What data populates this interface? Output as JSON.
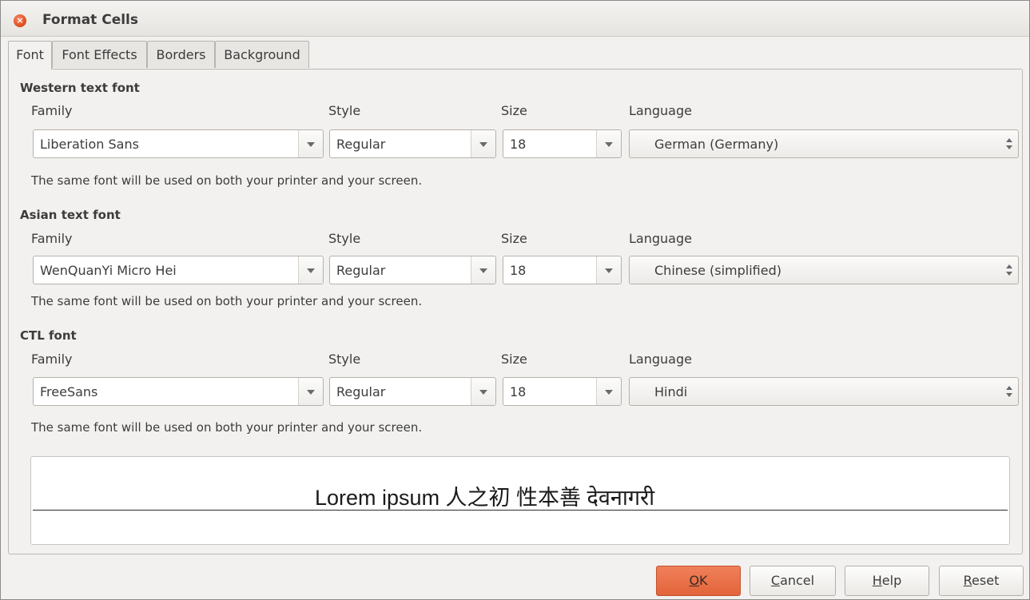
{
  "window": {
    "title": "Format Cells"
  },
  "tabs": [
    "Font",
    "Font Effects",
    "Borders",
    "Background"
  ],
  "active_tab": "Font",
  "sections": [
    {
      "title": "Western text font",
      "family_label": "Family",
      "style_label": "Style",
      "size_label": "Size",
      "language_label": "Language",
      "family": "Liberation Sans",
      "style": "Regular",
      "size": "18",
      "language": "German (Germany)",
      "note": "The same font will be used on both your printer and your screen."
    },
    {
      "title": "Asian text font",
      "family_label": "Family",
      "style_label": "Style",
      "size_label": "Size",
      "language_label": "Language",
      "family": "WenQuanYi Micro Hei",
      "style": "Regular",
      "size": "18",
      "language": "Chinese (simplified)",
      "note": "The same font will be used on both your printer and your screen."
    },
    {
      "title": "CTL font",
      "family_label": "Family",
      "style_label": "Style",
      "size_label": "Size",
      "language_label": "Language",
      "family": "FreeSans",
      "style": "Regular",
      "size": "18",
      "language": "Hindi",
      "note": "The same font will be used on both your printer and your screen."
    }
  ],
  "preview": {
    "text": "Lorem ipsum   人之初 性本善   देवनागरी"
  },
  "buttons": {
    "ok": {
      "mnemonic": "O",
      "rest": "K"
    },
    "cancel": {
      "mnemonic": "C",
      "rest": "ancel"
    },
    "help": {
      "mnemonic": "H",
      "rest": "elp"
    },
    "reset": {
      "mnemonic": "R",
      "rest": "eset"
    }
  },
  "colors": {
    "accent": "#e2643a",
    "close": "#dd4814"
  }
}
